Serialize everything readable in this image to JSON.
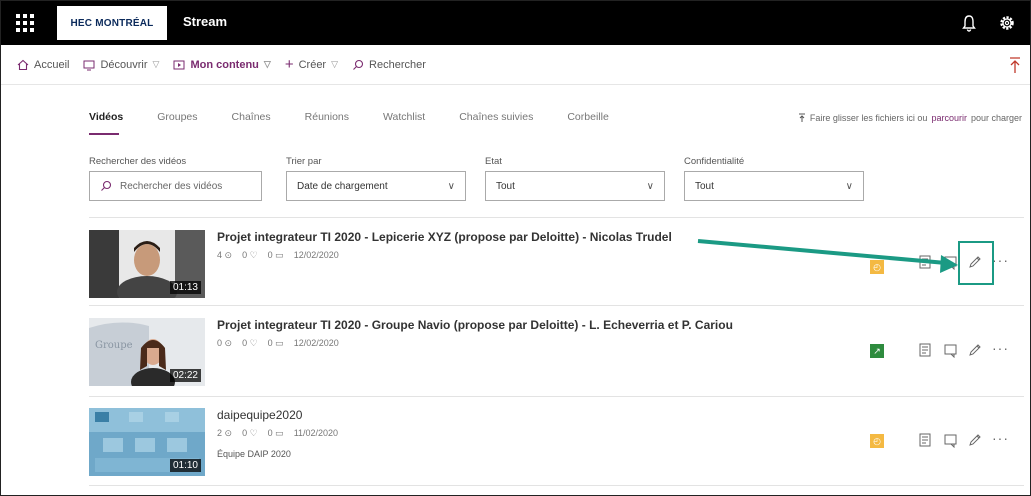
{
  "topbar": {
    "org_logo": "HEC MONTRÉAL",
    "app_name": "Stream"
  },
  "nav": {
    "home": "Accueil",
    "discover": "Découvrir",
    "my_content": "Mon contenu",
    "create": "Créer",
    "search": "Rechercher"
  },
  "tabs": [
    "Vidéos",
    "Groupes",
    "Chaînes",
    "Réunions",
    "Watchlist",
    "Chaînes suivies",
    "Corbeille"
  ],
  "drop_hint": {
    "prefix": "Faire glisser les fichiers ici ou",
    "link": "parcourir",
    "suffix": "pour charger"
  },
  "filters": {
    "search": {
      "label": "Rechercher des vidéos",
      "placeholder": "Rechercher des vidéos"
    },
    "sort": {
      "label": "Trier par",
      "value": "Date de chargement"
    },
    "state": {
      "label": "Etat",
      "value": "Tout"
    },
    "privacy": {
      "label": "Confidentialité",
      "value": "Tout"
    }
  },
  "videos": [
    {
      "title": "Projet integrateur TI 2020 - Lepicerie XYZ (propose par Deloitte) - Nicolas Trudel",
      "views": "4",
      "likes": "0",
      "comments": "0",
      "date": "12/02/2020",
      "duration": "01:13",
      "group": "",
      "badge_color": "#f4b942"
    },
    {
      "title": "Projet integrateur TI 2020 - Groupe Navio (propose par Deloitte) - L. Echeverria et P. Cariou",
      "views": "0",
      "likes": "0",
      "comments": "0",
      "date": "12/02/2020",
      "duration": "02:22",
      "group": "",
      "badge_color": "#2e8b3e"
    },
    {
      "title": "daipequipe2020",
      "views": "2",
      "likes": "0",
      "comments": "0",
      "date": "11/02/2020",
      "duration": "01:10",
      "group": "Équipe DAIP 2020",
      "badge_color": "#f4b942"
    }
  ],
  "colors": {
    "accent": "#7a2b6f",
    "annotation": "#1b9a84"
  }
}
